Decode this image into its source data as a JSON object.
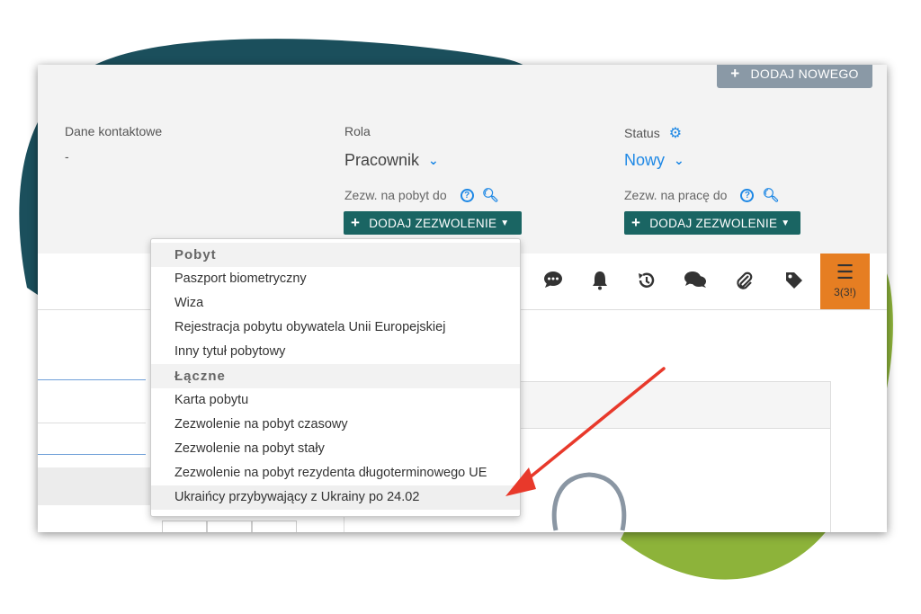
{
  "header": {
    "add_new_label": "DODAJ NOWEGO",
    "contact": {
      "label": "Dane kontaktowe",
      "value": "-"
    },
    "role": {
      "label": "Rola",
      "value": "Pracownik"
    },
    "status": {
      "label": "Status",
      "value": "Nowy"
    },
    "residence_permit": {
      "label": "Zezw. na pobyt do",
      "button_label": "DODAJ ZEZWOLENIE"
    },
    "work_permit": {
      "label": "Zezw. na pracę do",
      "button_label": "DODAJ ZEZWOLENIE"
    }
  },
  "toolbar": {
    "icons": [
      "comment-icon",
      "bell-icon",
      "history-icon",
      "comments-icon",
      "paperclip-icon",
      "tag-icon",
      "tasks-icon"
    ],
    "tasks_count": "3(3!)",
    "tasks_color": "#e67e22"
  },
  "permit_menu": {
    "sections": [
      {
        "title": "Pobyt",
        "items": [
          "Paszport biometryczny",
          "Wiza",
          "Rejestracja pobytu obywatela Unii Europejskiej",
          "Inny tytuł pobytowy"
        ]
      },
      {
        "title": "Łączne",
        "items": [
          "Karta pobytu",
          "Zezwolenie na pobyt czasowy",
          "Zezwolenie na pobyt stały",
          "Zezwolenie na pobyt rezydenta długoterminowego UE",
          "Ukraińcy przybywający z Ukrainy po 24.02"
        ]
      }
    ],
    "highlighted_item": "Ukraińcy przybywający z Ukrainy po 24.02"
  },
  "colors": {
    "dark_teal": "#1b4f5c",
    "green": "#8db33a",
    "button_teal": "#1a6563",
    "accent_blue": "#1e88e5",
    "arrow_red": "#e8392b"
  }
}
